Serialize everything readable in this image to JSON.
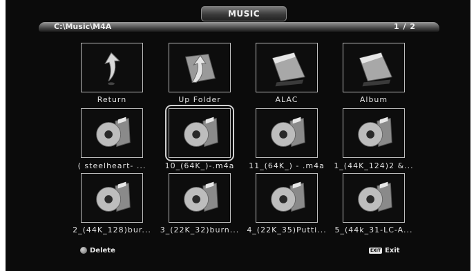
{
  "header": {
    "title": "MUSIC",
    "path": "C:\\Music\\M4A",
    "page": "1 / 2"
  },
  "items": [
    {
      "label": "Return",
      "icon": "return-arrow-icon"
    },
    {
      "label": "Up Folder",
      "icon": "up-folder-icon"
    },
    {
      "label": "ALAC",
      "icon": "folder-icon"
    },
    {
      "label": "Album",
      "icon": "folder-icon"
    },
    {
      "label": "( steelheart-      ...",
      "icon": "music-file-icon"
    },
    {
      "label": "10_(64K_)-.m4a",
      "icon": "music-file-icon"
    },
    {
      "label": "11_(64K_) - .m4a",
      "icon": "music-file-icon"
    },
    {
      "label": "1_(44K_124)2 &...",
      "icon": "music-file-icon"
    },
    {
      "label": "2_(44K_128)bur...",
      "icon": "music-file-icon"
    },
    {
      "label": "3_(22K_32)burn...",
      "icon": "music-file-icon"
    },
    {
      "label": "4_(22K_35)Putti...",
      "icon": "music-file-icon"
    },
    {
      "label": "5_(44k_31-LC-A...",
      "icon": "music-file-icon"
    }
  ],
  "selected_index": 5,
  "footer": {
    "delete_label": "Delete",
    "exit_badge": "EXIT",
    "exit_label": "Exit"
  }
}
